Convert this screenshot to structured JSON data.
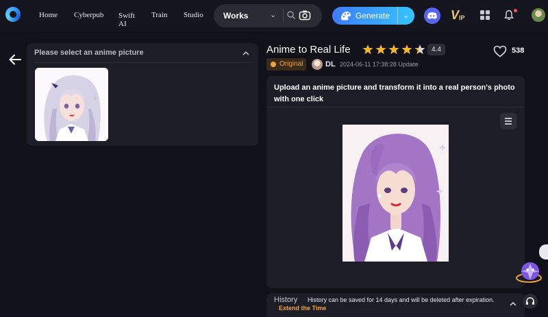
{
  "nav": {
    "home": "Home",
    "cyberpub": "Cyberpub",
    "swift_l1": "Swift",
    "swift_l2": "AI",
    "train": "Train",
    "studio": "Studio"
  },
  "search": {
    "selected": "Works"
  },
  "generate": {
    "label": "Generate"
  },
  "left_panel": {
    "title": "Please select an anime picture"
  },
  "app": {
    "title": "Anime to Real Life",
    "rating": "4.4",
    "stars_filled": 4.4,
    "likes": "538",
    "badge": "Original",
    "author": "DL",
    "updated": "2024-06-11 17:38:28 Update",
    "description": "Upload an anime picture and transform it into a real person's photo with one click"
  },
  "history": {
    "label": "History",
    "note": "History can be saved for 14 days and will be deleted after expiration.",
    "link": "Extend the Time"
  },
  "colors": {
    "accent_blue": "#3e7cff",
    "accent_cyan": "#36c4ff",
    "orange": "#f0a23a",
    "star": "#f5b731",
    "background": "#111119",
    "panel": "#1d1d27"
  }
}
